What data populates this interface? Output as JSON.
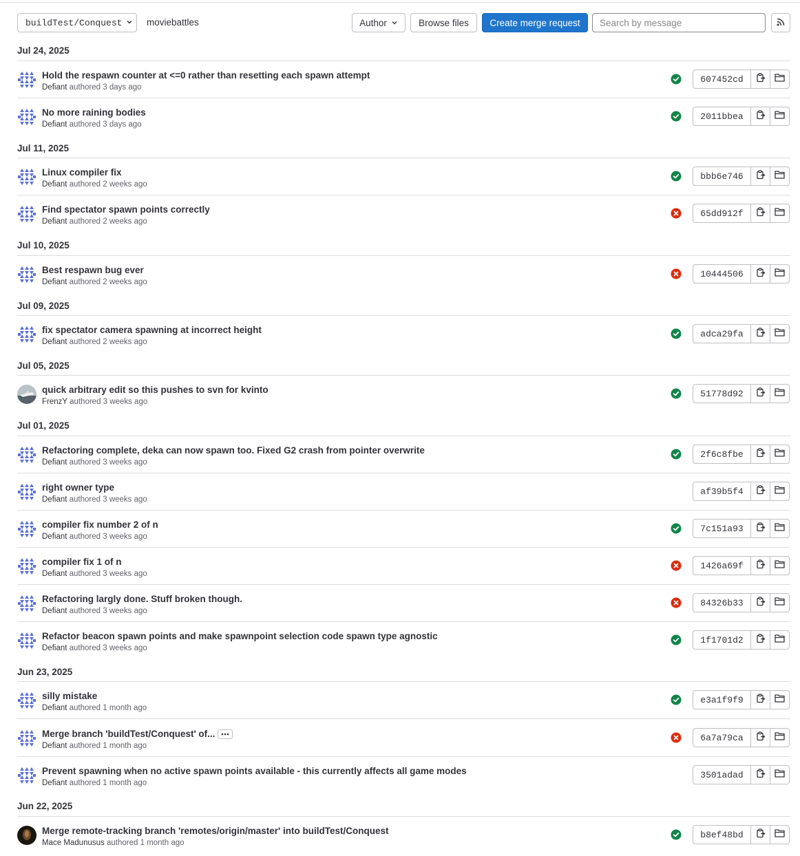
{
  "toolbar": {
    "branch": "buildTest/Conquest",
    "path": "moviebattles",
    "author_label": "Author",
    "browse_files_label": "Browse files",
    "create_mr_label": "Create merge request",
    "search_placeholder": "Search by message",
    "rss_icon": "rss-icon"
  },
  "colors": {
    "primary_button": "#1f75cb",
    "success": "#108548",
    "failed": "#dd2b0e",
    "avatar_identicon": "#5b6fd6"
  },
  "authored_word": "authored",
  "groups": [
    {
      "date": "Jul 24, 2025",
      "commits": [
        {
          "title": "Hold the respawn counter at <=0 rather than resetting each spawn attempt",
          "author": "Defiant",
          "time": "3 days ago",
          "status": "success",
          "sha": "607452cd",
          "avatar": "identicon"
        },
        {
          "title": "No more raining bodies",
          "author": "Defiant",
          "time": "3 days ago",
          "status": "success",
          "sha": "2011bbea",
          "avatar": "identicon"
        }
      ]
    },
    {
      "date": "Jul 11, 2025",
      "commits": [
        {
          "title": "Linux compiler fix",
          "author": "Defiant",
          "time": "2 weeks ago",
          "status": "success",
          "sha": "bbb6e746",
          "avatar": "identicon"
        },
        {
          "title": "Find spectator spawn points correctly",
          "author": "Defiant",
          "time": "2 weeks ago",
          "status": "failed",
          "sha": "65dd912f",
          "avatar": "identicon"
        }
      ]
    },
    {
      "date": "Jul 10, 2025",
      "commits": [
        {
          "title": "Best respawn bug ever",
          "author": "Defiant",
          "time": "2 weeks ago",
          "status": "failed",
          "sha": "10444506",
          "avatar": "identicon"
        }
      ]
    },
    {
      "date": "Jul 09, 2025",
      "commits": [
        {
          "title": "fix spectator camera spawning at incorrect height",
          "author": "Defiant",
          "time": "2 weeks ago",
          "status": "success",
          "sha": "adca29fa",
          "avatar": "identicon"
        }
      ]
    },
    {
      "date": "Jul 05, 2025",
      "commits": [
        {
          "title": "quick arbitrary edit so this pushes to svn for kvinto",
          "author": "FrenzY",
          "time": "3 weeks ago",
          "status": "success",
          "sha": "51778d92",
          "avatar": "photo-plane"
        }
      ]
    },
    {
      "date": "Jul 01, 2025",
      "commits": [
        {
          "title": "Refactoring complete, deka can now spawn too. Fixed G2 crash from pointer overwrite",
          "author": "Defiant",
          "time": "3 weeks ago",
          "status": "success",
          "sha": "2f6c8fbe",
          "avatar": "identicon"
        },
        {
          "title": "right owner type",
          "author": "Defiant",
          "time": "3 weeks ago",
          "status": "none",
          "sha": "af39b5f4",
          "avatar": "identicon"
        },
        {
          "title": "compiler fix number 2 of n",
          "author": "Defiant",
          "time": "3 weeks ago",
          "status": "success",
          "sha": "7c151a93",
          "avatar": "identicon"
        },
        {
          "title": "compiler fix 1 of n",
          "author": "Defiant",
          "time": "3 weeks ago",
          "status": "failed",
          "sha": "1426a69f",
          "avatar": "identicon"
        },
        {
          "title": "Refactoring largly done. Stuff broken though.",
          "author": "Defiant",
          "time": "3 weeks ago",
          "status": "failed",
          "sha": "84326b33",
          "avatar": "identicon"
        },
        {
          "title": "Refactor beacon spawn points and make spawnpoint selection code spawn type agnostic",
          "author": "Defiant",
          "time": "3 weeks ago",
          "status": "success",
          "sha": "1f1701d2",
          "avatar": "identicon"
        }
      ]
    },
    {
      "date": "Jun 23, 2025",
      "commits": [
        {
          "title": "silly mistake",
          "author": "Defiant",
          "time": "1 month ago",
          "status": "success",
          "sha": "e3a1f9f9",
          "avatar": "identicon"
        },
        {
          "title": "Merge branch 'buildTest/Conquest' of...",
          "author": "Defiant",
          "time": "1 month ago",
          "status": "failed",
          "sha": "6a7a79ca",
          "avatar": "identicon",
          "has_ellipsis": true
        },
        {
          "title": "Prevent spawning when no active spawn points available - this currently affects all game modes",
          "author": "Defiant",
          "time": "1 month ago",
          "status": "none",
          "sha": "3501adad",
          "avatar": "identicon"
        }
      ]
    },
    {
      "date": "Jun 22, 2025",
      "commits": [
        {
          "title": "Merge remote-tracking branch 'remotes/origin/master' into buildTest/Conquest",
          "author": "Mace Madunusus",
          "time": "1 month ago",
          "status": "success",
          "sha": "b8ef48bd",
          "avatar": "photo-dark"
        }
      ]
    }
  ]
}
